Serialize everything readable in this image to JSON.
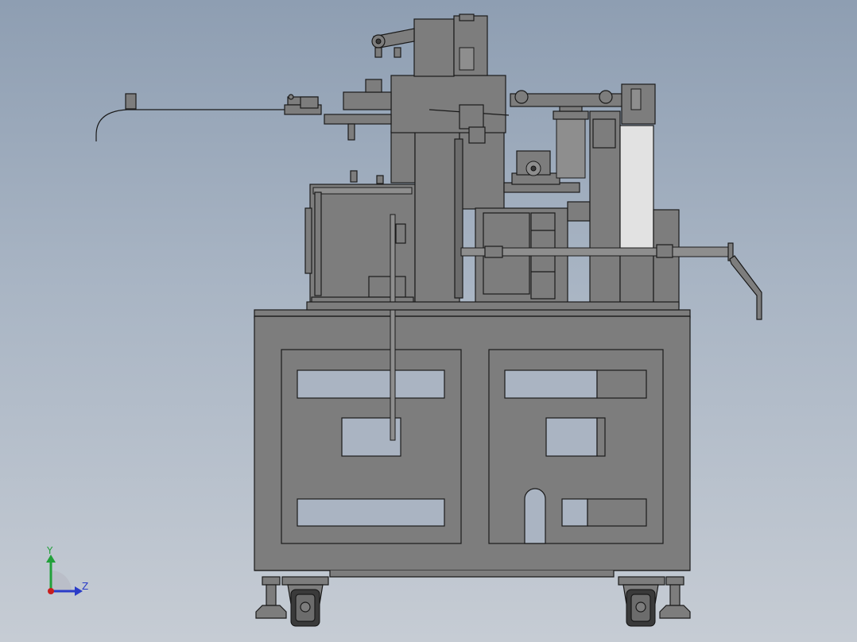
{
  "viewport": {
    "background_top": "#8e9eb2",
    "background_bottom": "#c6ccd4"
  },
  "machine": {
    "body_color": "#7d7d7d",
    "edge_color": "#1a1a1a",
    "light_panel_color": "#aab4c2",
    "white_panel_color": "#e2e2e2"
  },
  "triad": {
    "y_label": "Y",
    "z_label": "Z",
    "y_color": "#22a03a",
    "z_color": "#2a3cc8",
    "x_color": "#c81e1e"
  }
}
